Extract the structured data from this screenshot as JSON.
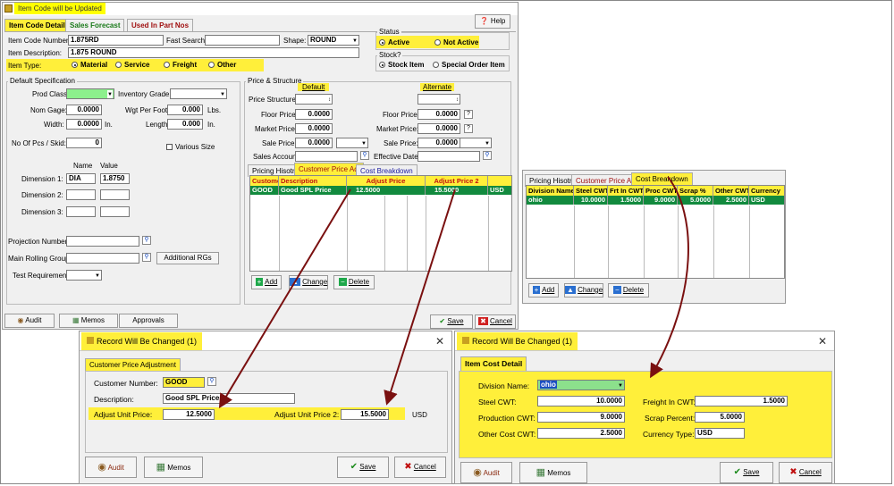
{
  "main": {
    "title": "Item Code will be Updated",
    "tabs": [
      "Item Code Details",
      "Sales Forecast",
      "Used In Part Nos"
    ],
    "help_label": "Help",
    "item_code_label": "Item Code Number:",
    "item_code_value": "1.875RD",
    "fast_search_label": "Fast Search:",
    "shape_label": "Shape:",
    "shape_value": "ROUND",
    "item_desc_label": "Item Description:",
    "item_desc_value": "1.875 ROUND",
    "item_type_label": "Item Type:",
    "item_types": [
      "Material",
      "Service",
      "Freight",
      "Other"
    ],
    "status_label": "Status",
    "status_options": [
      "Active",
      "Not Active"
    ],
    "stock_label": "Stock?",
    "stock_options": [
      "Stock Item",
      "Special Order Item"
    ],
    "default_spec_label": "Default Specification",
    "prod_class_label": "Prod Class:",
    "inventory_grade_label": "Inventory Grade:",
    "nom_gage_label": "Nom Gage:",
    "nom_gage_value": "0.0000",
    "wgt_per_foot_label": "Wgt Per Foot:",
    "wgt_per_foot_value": "0.000",
    "lbs_label": "Lbs.",
    "width_label": "Width:",
    "width_value": "0.0000",
    "in_label": "In.",
    "length_label": "Length:",
    "length_value": "0.000",
    "no_pcs_label": "No Of Pcs / Skid:",
    "no_pcs_value": "0",
    "various_size_label": "Various Size",
    "name_header": "Name",
    "value_header": "Value",
    "dimension1_label": "Dimension 1:",
    "dimension1_name": "DIA",
    "dimension1_value": "1.8750",
    "dimension2_label": "Dimension 2:",
    "dimension3_label": "Dimension 3:",
    "projection_number_label": "Projection Number:",
    "main_rolling_group_label": "Main Rolling Group:",
    "additional_rgs_label": "Additional RGs",
    "test_requirement_label": "Test Requirement:",
    "price_structure_group": "Price & Structure",
    "default_header": "Default",
    "alternate_header": "Alternate",
    "price_structure_label": "Price Structure:",
    "floor_price_label": "Floor Price:",
    "market_price_label": "Market Price:",
    "sale_price_label": "Sale Price:",
    "sales_account_label": "Sales Account:",
    "effective_date_label": "Effective Date:",
    "price_value": "0.0000",
    "question_mark": "?",
    "sub_tabs": [
      "Pricing Hisotry",
      "Customer Price Adj",
      "Cost Breakdown"
    ],
    "cpa_grid": {
      "headers": [
        "Custome",
        "Description",
        "Adjust Price",
        "Adjust Price 2",
        ""
      ],
      "row": [
        "GOOD",
        "Good SPL Price",
        "12.5000",
        "15.5000",
        "USD"
      ]
    },
    "add_label": "Add",
    "change_label": "Change",
    "delete_label": "Delete",
    "audit_label": "Audit",
    "memos_label": "Memos",
    "approvals_label": "Approvals",
    "save_label": "Save",
    "cancel_label": "Cancel"
  },
  "cost_panel": {
    "tabs": [
      "Pricing Hisotry",
      "Customer Price Ad",
      "Cost Breakdown"
    ],
    "headers": [
      "Division Name",
      "Steel CWT",
      "Frt In CWT",
      "Proc CWT",
      "Scrap %",
      "Other CWT",
      "Currency"
    ],
    "row": [
      "ohio",
      "10.0000",
      "1.5000",
      "9.0000",
      "5.0000",
      "2.5000",
      "USD"
    ],
    "add_label": "Add",
    "change_label": "Change",
    "delete_label": "Delete"
  },
  "dialog1": {
    "title": "Record Will Be Changed  (1)",
    "tab": "Customer Price Adjustment",
    "customer_number_label": "Customer Number:",
    "customer_number_value": "GOOD",
    "description_label": "Description:",
    "description_value": "Good SPL Price",
    "adjust_price_label": "Adjust Unit Price:",
    "adjust_price_value": "12.5000",
    "adjust_price2_label": "Adjust Unit Price 2:",
    "adjust_price2_value": "15.5000",
    "currency": "USD",
    "audit_label": "Audit",
    "memos_label": "Memos",
    "save_label": "Save",
    "cancel_label": "Cancel"
  },
  "dialog2": {
    "title": "Record Will Be Changed  (1)",
    "tab": "Item Cost Detail",
    "division_label": "Division Name:",
    "division_value": "ohio",
    "steel_cwt_label": "Steel CWT:",
    "steel_cwt_value": "10.0000",
    "freight_label": "Freight In CWT:",
    "freight_value": "1.5000",
    "production_label": "Production CWT:",
    "production_value": "9.0000",
    "scrap_label": "Scrap Percent:",
    "scrap_value": "5.0000",
    "other_label": "Other Cost CWT:",
    "other_value": "2.5000",
    "currency_label": "Currency Type:",
    "currency_value": "USD",
    "audit_label": "Audit",
    "memos_label": "Memos",
    "save_label": "Save",
    "cancel_label": "Cancel"
  },
  "colors": {
    "highlight": "#ffef3a",
    "grid_row": "#128a3e",
    "arrow": "#7a1010"
  }
}
